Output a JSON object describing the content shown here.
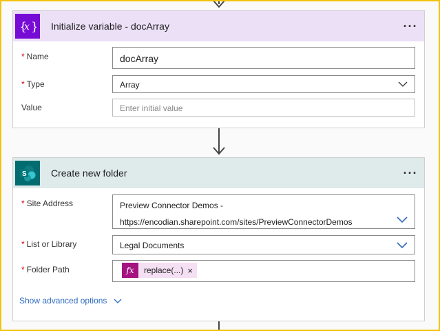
{
  "card1": {
    "title": "Initialize variable - docArray",
    "icon": "variable-icon",
    "more_label": "···",
    "fields": {
      "name": {
        "label": "Name",
        "required": "*",
        "value": "docArray"
      },
      "type": {
        "label": "Type",
        "required": "*",
        "value": "Array"
      },
      "value": {
        "label": "Value",
        "placeholder": "Enter initial value"
      }
    }
  },
  "card2": {
    "title": "Create new folder",
    "icon": "sharepoint-icon",
    "more_label": "···",
    "fields": {
      "site": {
        "label": "Site Address",
        "required": "*",
        "line1": "Preview Connector Demos -",
        "line2": "https://encodian.sharepoint.com/sites/PreviewConnectorDemos"
      },
      "library": {
        "label": "List or Library",
        "required": "*",
        "value": "Legal Documents"
      },
      "folder": {
        "label": "Folder Path",
        "required": "*",
        "token": "replace(...)",
        "token_icon": "fx",
        "token_remove": "×"
      }
    },
    "advanced_label": "Show advanced options"
  },
  "colors": {
    "variable_header": "#ece0f7",
    "variable_icon": "#770bd6",
    "sharepoint_header": "#dfeaea",
    "sharepoint_icon": "#036c70",
    "link": "#2f6bbf",
    "expression_token": "#a4137f"
  }
}
